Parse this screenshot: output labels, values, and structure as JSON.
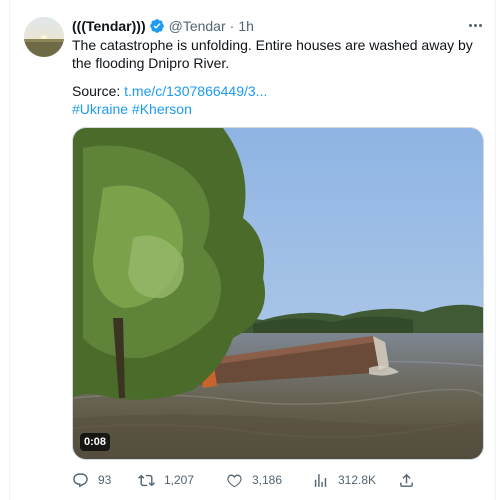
{
  "tweet": {
    "author": {
      "display_name": "(((Tendar)))",
      "handle": "@Tendar",
      "verified": true
    },
    "time": "1h",
    "separator": "·",
    "text": "The catastrophe is unfolding. Entire houses are washed away by the flooding Dnipro River.",
    "source_label": "Source:",
    "source_link": "t.me/c/1307866449/3...",
    "hashtags": [
      "#Ukraine",
      "#Kherson"
    ],
    "media": {
      "type": "video",
      "duration": "0:08"
    },
    "stats": {
      "replies": "93",
      "retweets": "1,207",
      "likes": "3,186",
      "views": "312.8K"
    }
  },
  "colors": {
    "link": "#1d9bf0",
    "secondary_text": "#536471",
    "verified_badge": "#1d9bf0"
  },
  "icons": {
    "more": "more-horizontal-icon",
    "reply": "reply-icon",
    "retweet": "retweet-icon",
    "like": "heart-icon",
    "views": "views-chart-icon",
    "share": "share-icon"
  }
}
